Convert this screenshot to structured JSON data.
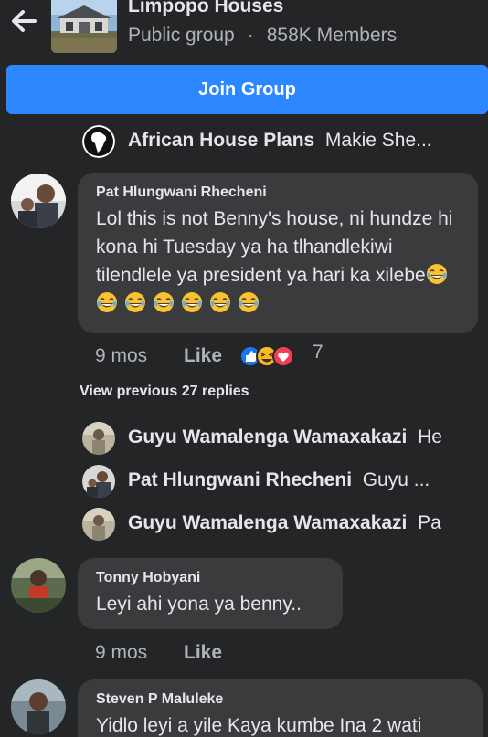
{
  "group": {
    "name": "Limpopo Houses",
    "privacy": "Public group",
    "separator": "·",
    "members": "858K Members",
    "join_label": "Join Group"
  },
  "icons": {
    "back": "arrow-left-icon",
    "emoji": "face-with-tears-of-joy-icon",
    "reactions": [
      "like-reaction-icon",
      "haha-reaction-icon",
      "love-reaction-icon"
    ]
  },
  "colors": {
    "background": "#242526",
    "bubble": "#3a3b3c",
    "accent": "#2d88ff",
    "secondary_text": "#b0b3b8"
  },
  "top_reply": {
    "name": "African House Plans",
    "snippet": "Makie She..."
  },
  "comments": [
    {
      "author": "Pat Hlungwani Rhecheni",
      "text": "Lol this is not Benny's house, ni hundze hi kona hi Tuesday ya ha tlhandlekiwi tilendlele ya president ya hari ka xilebe",
      "emoji_count": 7,
      "time": "9 mos",
      "like_label": "Like",
      "reaction_count": "7"
    },
    {
      "author": "Tonny Hobyani",
      "text": "Leyi ahi yona ya benny..",
      "time": "9 mos",
      "like_label": "Like"
    },
    {
      "author": "Steven P Maluleke",
      "text": "Yidlo leyi a yile Kaya kumbe Ina 2 wati"
    }
  ],
  "view_previous": "View previous 27 replies",
  "replies": [
    {
      "name": "Guyu Wamalenga Wamaxakazi",
      "snippet": "He"
    },
    {
      "name": "Pat Hlungwani Rhecheni",
      "snippet": "Guyu ..."
    },
    {
      "name": "Guyu Wamalenga Wamaxakazi",
      "snippet": "Pa"
    }
  ]
}
